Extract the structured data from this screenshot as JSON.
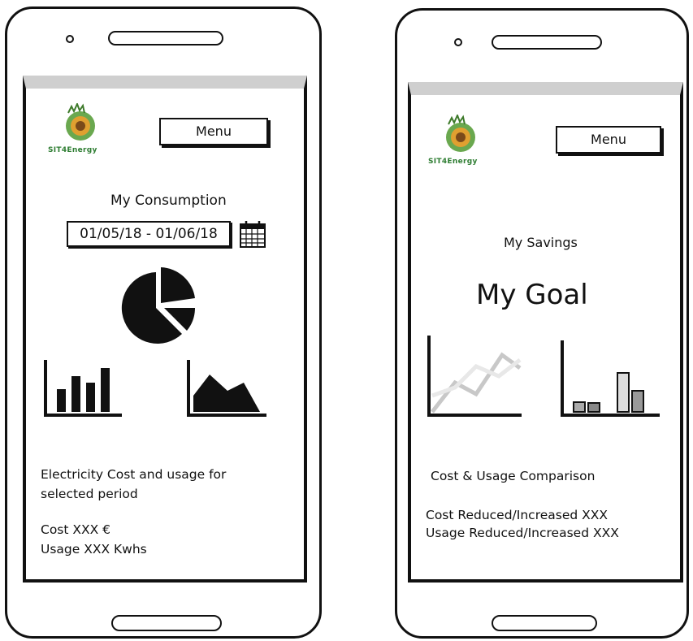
{
  "screen1": {
    "logo_text": "SIT4Energy",
    "menu_label": "Menu",
    "title": "My Consumption",
    "date_range": "01/05/18 - 01/06/18",
    "description_line1": "Electricity Cost and usage for",
    "description_line2": "selected period",
    "cost": "Cost  XXX €",
    "usage": "Usage XXX Kwhs"
  },
  "screen2": {
    "logo_text": "SIT4Energy",
    "menu_label": "Menu",
    "title": "My Savings",
    "goal": "My Goal",
    "comparison_title": "Cost & Usage Comparison",
    "cost_line": "Cost Reduced/Increased XXX",
    "usage_line": "Usage Reduced/Increased XXX"
  },
  "colors": {
    "logo_green": "#2e7d32",
    "logo_orange": "#e0a030",
    "status_bar": "#cfcfcf"
  }
}
